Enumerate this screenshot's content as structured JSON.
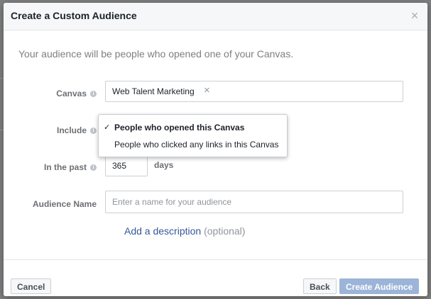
{
  "dialog": {
    "title": "Create a Custom Audience",
    "close_icon": "×",
    "intro": "Your audience will be people who opened one of your Canvas."
  },
  "form": {
    "canvas": {
      "label": "Canvas",
      "token": "Web Talent Marketing",
      "remove_icon": "×"
    },
    "include": {
      "label": "Include",
      "options": [
        {
          "label": "People who opened this Canvas",
          "selected": true
        },
        {
          "label": "People who clicked any links in this Canvas",
          "selected": false
        }
      ],
      "check": "✓"
    },
    "in_the_past": {
      "label": "In the past",
      "value": "365",
      "unit": "days"
    },
    "audience_name": {
      "label": "Audience Name",
      "placeholder": "Enter a name for your audience"
    },
    "description": {
      "link": "Add a description",
      "optional": "(optional)"
    },
    "info_icon": "i"
  },
  "footer": {
    "cancel": "Cancel",
    "back": "Back",
    "create": "Create Audience"
  },
  "colors": {
    "link": "#365899",
    "primary_disabled": "#9cb4d8"
  }
}
